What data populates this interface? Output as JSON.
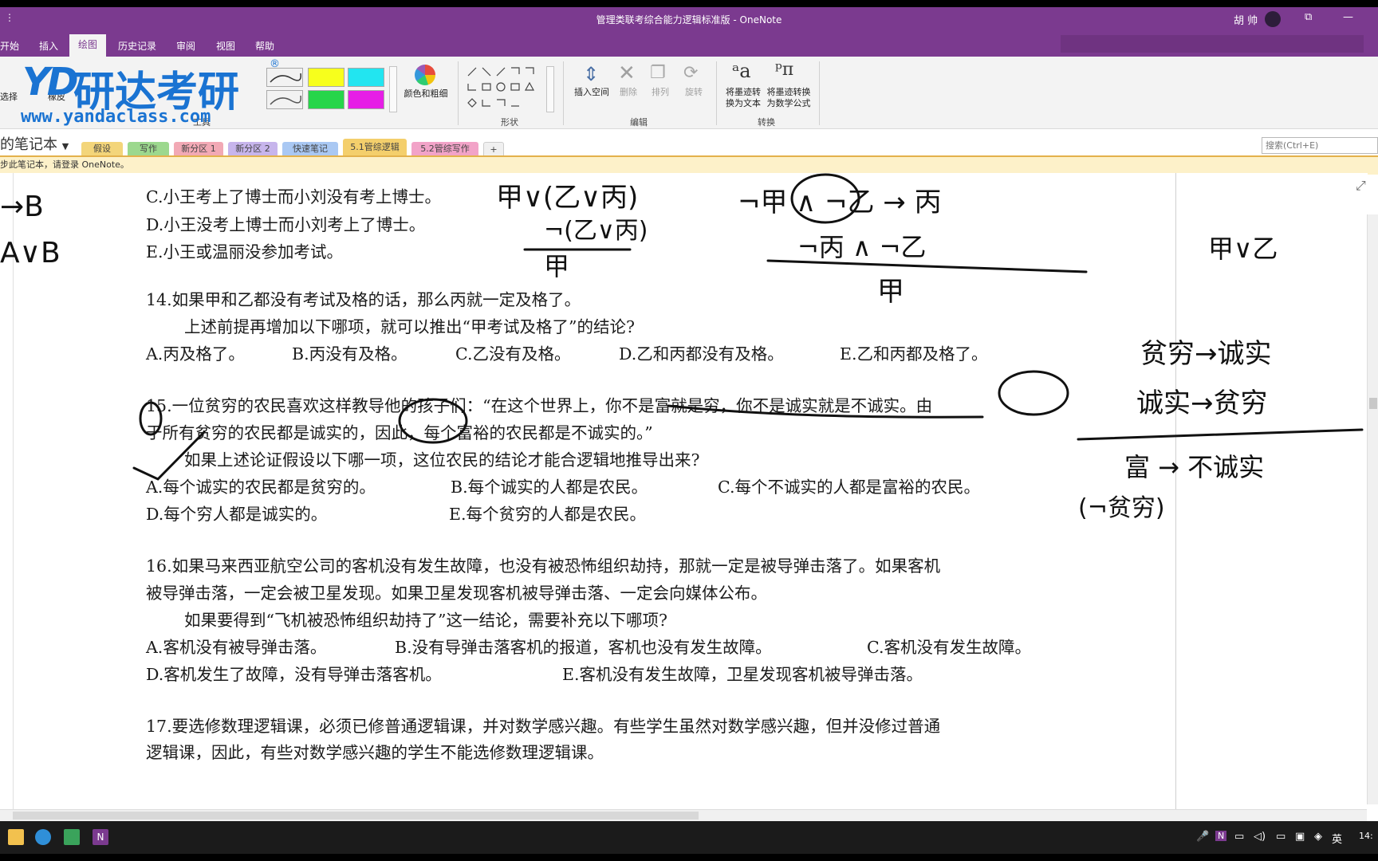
{
  "window": {
    "title": "管理类联考综合能力逻辑标准版  -  OneNote",
    "user": "胡 帅",
    "restore_icon": "restore-window-icon",
    "minimize_icon": "minimize-icon"
  },
  "menu_tabs": [
    "开始",
    "插入",
    "绘图",
    "历史记录",
    "审阅",
    "视图",
    "帮助"
  ],
  "active_menu": "绘图",
  "watermark": {
    "brand": "研达考研",
    "url": "www.yandaclass.com",
    "mark": "YD",
    "reg": "®"
  },
  "ribbon": {
    "partial_labels": [
      "选择",
      "橡皮"
    ],
    "pen_colors": [
      "#f7ff1c",
      "#22e5f0",
      "#27d54a",
      "#e61ee6"
    ],
    "color_button": "颜色和粗细",
    "shapes_label": "形状",
    "insert_space": "插入空间",
    "delete": "删除",
    "arrange": "排列",
    "rotate": "旋转",
    "edit_label": "编辑",
    "ink_to_text": "将墨迹转换为文本",
    "ink_to_math": "将墨迹转换为数学公式",
    "convert_label": "转换",
    "tools_label": "工具"
  },
  "notebook": {
    "name": "的笔记本"
  },
  "section_tabs": [
    {
      "label": "假设",
      "color": "#f3d57a"
    },
    {
      "label": "写作",
      "color": "#9cd88e"
    },
    {
      "label": "新分区 1",
      "color": "#f2a9b5"
    },
    {
      "label": "新分区 2",
      "color": "#c7b5ec"
    },
    {
      "label": "快速笔记",
      "color": "#a9c8f3"
    },
    {
      "label": "5.1管综逻辑",
      "color": "#f4cf6c"
    },
    {
      "label": "5.2管综写作",
      "color": "#f2a3c8"
    }
  ],
  "add_section": "+",
  "search": {
    "placeholder": "搜索(Ctrl+E)"
  },
  "info_bar": "步此笔记本，请登录 OneNote。",
  "content": {
    "q13_c": "C.小王考上了博士而小刘没有考上博士。",
    "q13_d": "D.小王没考上博士而小刘考上了博士。",
    "q13_e": "E.小王或温丽没参加考试。",
    "q14_stem": "14.如果甲和乙都没有考试及格的话，那么丙就一定及格了。",
    "q14_ask": "上述前提再增加以下哪项，就可以推出“甲考试及格了”的结论?",
    "q14_a": "A.丙及格了。",
    "q14_b": "B.丙没有及格。",
    "q14_c": "C.乙没有及格。",
    "q14_d": "D.乙和丙都没有及格。",
    "q14_e": "E.乙和丙都及格了。",
    "q15_stem1": "15.一位贫穷的农民喜欢这样教导他的孩子们：“在这个世界上，你不是富就是穷，你不是诚实就是不诚实。由",
    "q15_stem2": "于所有贫穷的农民都是诚实的，因此，每个富裕的农民都是不诚实的。”",
    "q15_ask": "如果上述论证假设以下哪一项，这位农民的结论才能合逻辑地推导出来?",
    "q15_a": "A.每个诚实的农民都是贫穷的。",
    "q15_b": "B.每个诚实的人都是农民。",
    "q15_c": "C.每个不诚实的人都是富裕的农民。",
    "q15_d": "D.每个穷人都是诚实的。",
    "q15_e": "E.每个贫穷的人都是农民。",
    "q16_stem1": "16.如果马来西亚航空公司的客机没有发生故障，也没有被恐怖组织劫持，那就一定是被导弹击落了。如果客机",
    "q16_stem2": "被导弹击落，一定会被卫星发现。如果卫星发现客机被导弹击落、一定会向媒体公布。",
    "q16_ask": "如果要得到“飞机被恐怖组织劫持了”这一结论，需要补充以下哪项?",
    "q16_a": "A.客机没有被导弹击落。",
    "q16_b": "B.没有导弹击落客机的报道，客机也没有发生故障。",
    "q16_c": "C.客机没有发生故障。",
    "q16_d": "D.客机发生了故障，没有导弹击落客机。",
    "q16_e": "E.客机没有发生故障，卫星发现客机被导弹击落。",
    "q17_stem1": "17.要选修数理逻辑课，必须已修普通逻辑课，并对数学感兴趣。有些学生虽然对数学感兴趣，但并没修过普通",
    "q17_stem2": "逻辑课，因此，有些对数学感兴趣的学生不能选修数理逻辑课。"
  },
  "handwriting": {
    "left_1": "→B",
    "left_2": "A∨B",
    "q14_premise": "甲∨(乙∨丙)",
    "q14_neg": "¬(乙∨丙)",
    "q14_concl": "甲",
    "q14_rule": "¬甲 ∧ ¬乙 → 丙",
    "q14_prem2": "¬丙 ∧ ¬乙",
    "q14_concl2": "甲",
    "right_disj": "甲∨乙",
    "r1": "贫穷→诚实",
    "r2": "诚实→贫穷",
    "r3": "富 → 不诚实",
    "r4": "(¬贫穷)"
  },
  "taskbar": {
    "ime": "英",
    "time": "14:"
  }
}
